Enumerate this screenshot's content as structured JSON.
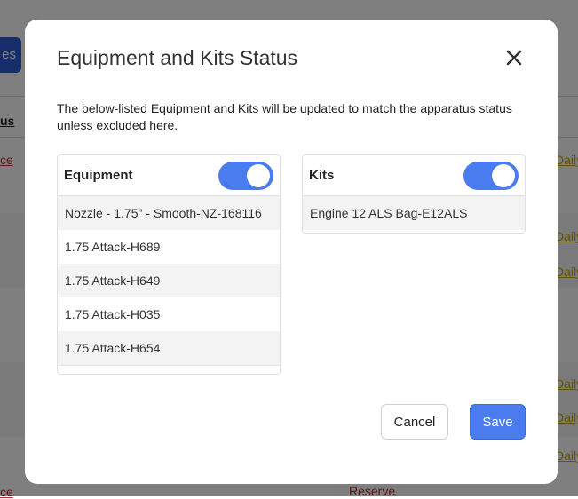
{
  "background": {
    "button_fragment": "es",
    "column_fragment": "us",
    "row_fragment": "ce",
    "link_fragment": "Daily",
    "reserve_text": "Reserve"
  },
  "modal": {
    "title": "Equipment and Kits Status",
    "description": "The below-listed Equipment and Kits will be updated to match the apparatus status unless excluded here.",
    "equipment": {
      "title": "Equipment",
      "toggle_on": true,
      "items": [
        "Nozzle - 1.75\" - Smooth-NZ-168116",
        "1.75 Attack-H689",
        "1.75 Attack-H649",
        "1.75 Attack-H035",
        "1.75 Attack-H654"
      ]
    },
    "kits": {
      "title": "Kits",
      "toggle_on": true,
      "items": [
        "Engine 12 ALS Bag-E12ALS"
      ]
    },
    "cancel_label": "Cancel",
    "save_label": "Save"
  },
  "colors": {
    "primary": "#4a7cf0",
    "overlay": "rgba(0,0,0,0.5)"
  }
}
